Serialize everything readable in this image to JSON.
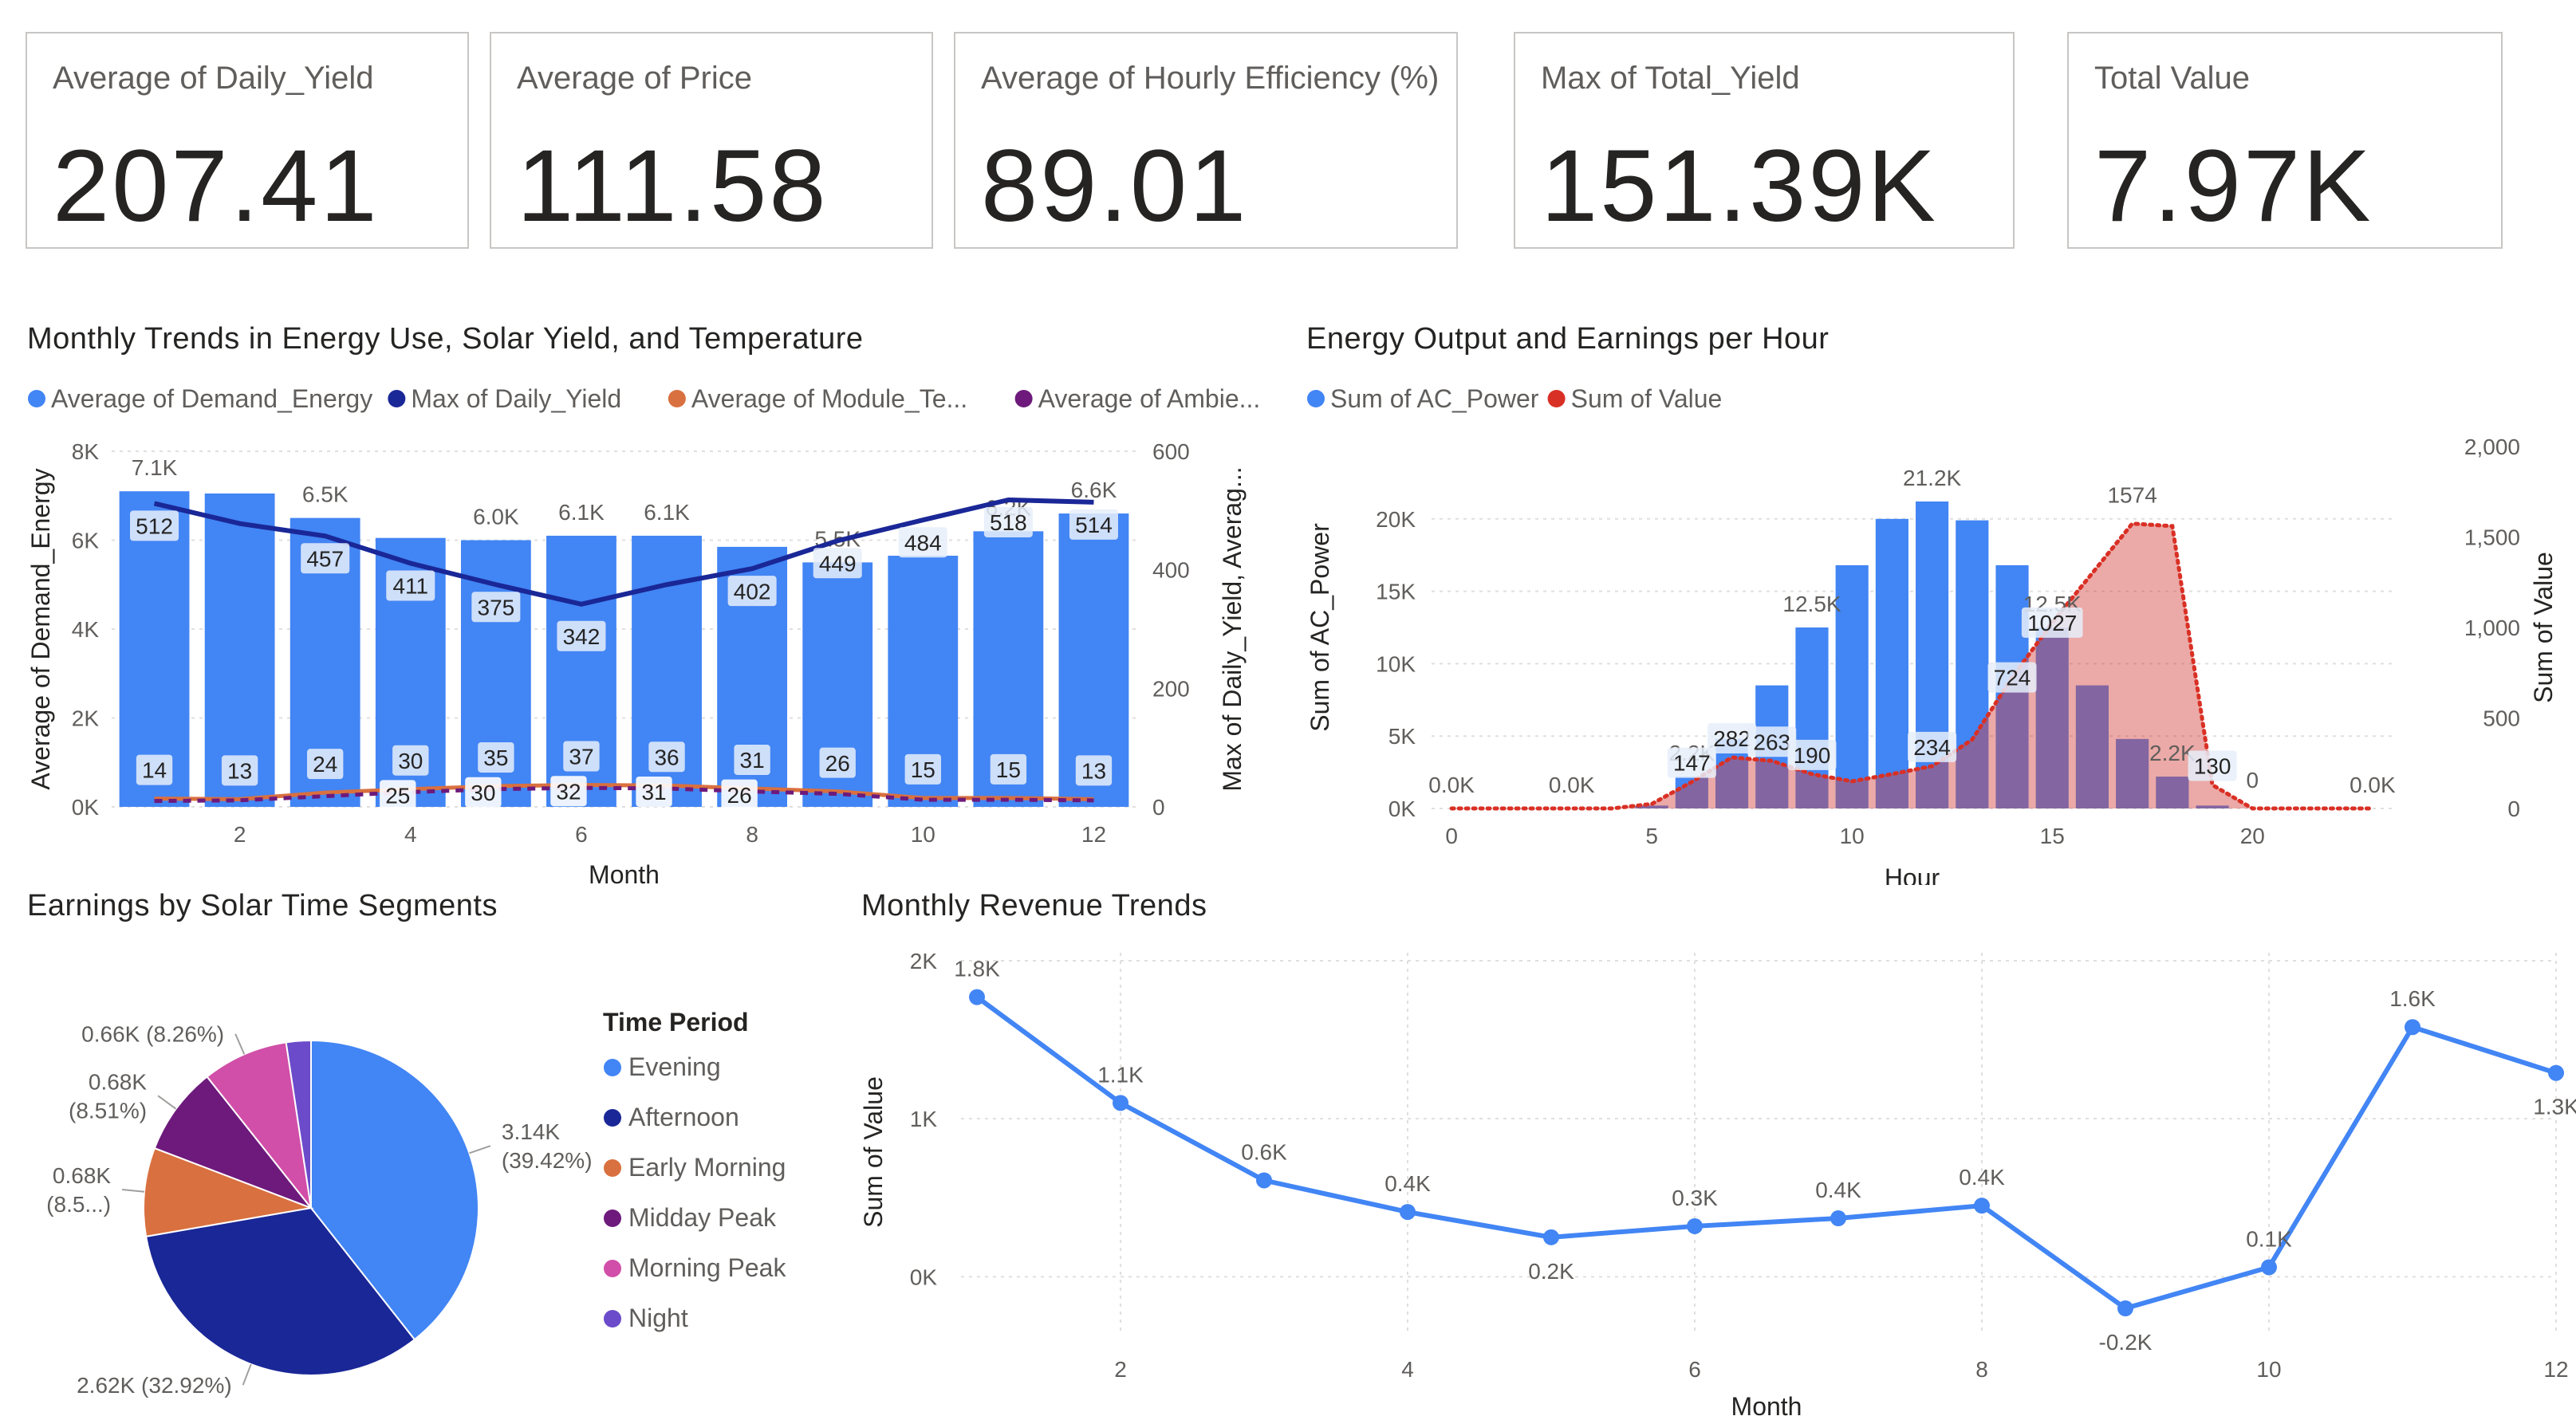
{
  "cards": [
    {
      "label": "Average of Daily_Yield",
      "value": "207.41"
    },
    {
      "label": "Average of Price",
      "value": "111.58"
    },
    {
      "label": "Average of Hourly Efficiency (%)",
      "value": "89.01"
    },
    {
      "label": "Max of Total_Yield",
      "value": "151.39K"
    },
    {
      "label": "Total Value",
      "value": "7.97K"
    }
  ],
  "colors": {
    "blue": "#4285f4",
    "navy": "#1a2797",
    "orange": "#d9703f",
    "purple": "#6d1a7c",
    "pink": "#d14fa8",
    "violet": "#6b4bc9",
    "red": "#d93025",
    "grid": "#e1dfdd",
    "text": "#605e5c"
  },
  "chart_data": [
    {
      "type": "bar",
      "title": "Monthly Trends in Energy Use, Solar Yield, and Temperature",
      "legend_position": "top-left",
      "legend": [
        "Average of Demand_Energy",
        "Max of Daily_Yield",
        "Average of Module_Te...",
        "Average of Ambie..."
      ],
      "xlabel": "Month",
      "ylabel": "Average of Demand_Energy",
      "ylabel_right": "Max of Daily_Yield, Averag...",
      "x": [
        1,
        2,
        3,
        4,
        5,
        6,
        7,
        8,
        9,
        10,
        11,
        12
      ],
      "x_ticks": [
        "2",
        "4",
        "6",
        "8",
        "10",
        "12"
      ],
      "y_ticks": [
        "0K",
        "2K",
        "4K",
        "6K",
        "8K"
      ],
      "y_right_ticks": [
        "0",
        "200",
        "400",
        "600"
      ],
      "ylim": [
        0,
        8000
      ],
      "ylim_right": [
        0,
        600
      ],
      "series": [
        {
          "name": "Average of Demand_Energy",
          "axis": "left",
          "kind": "bar",
          "values": [
            7100,
            7050,
            6500,
            6050,
            6000,
            6100,
            6100,
            5850,
            5500,
            5650,
            6200,
            6600
          ],
          "labels": [
            "7.1K",
            "",
            "6.5K",
            "",
            "6.0K",
            "6.1K",
            "6.1K",
            "",
            "5.5K",
            "",
            "6.2K",
            "6.6K"
          ]
        },
        {
          "name": "Max of Daily_Yield",
          "axis": "right",
          "kind": "line",
          "values": [
            512,
            478,
            457,
            411,
            375,
            342,
            375,
            402,
            449,
            484,
            518,
            514
          ],
          "labels": [
            "512",
            "",
            "457",
            "411",
            "375",
            "342",
            "",
            "402",
            "449",
            "484",
            "518",
            "514"
          ]
        },
        {
          "name": "Average of Module_Te...",
          "axis": "right",
          "kind": "line",
          "values": [
            14,
            13,
            24,
            30,
            35,
            37,
            36,
            31,
            26,
            15,
            15,
            13
          ],
          "labels": [
            "14",
            "13",
            "24",
            "30",
            "35",
            "37",
            "36",
            "31",
            "26",
            "15",
            "15",
            "13"
          ]
        },
        {
          "name": "Average of Ambie...",
          "axis": "right",
          "kind": "line",
          "values": [
            10,
            11,
            18,
            25,
            30,
            32,
            31,
            26,
            22,
            12,
            12,
            11
          ],
          "labels": [
            "",
            "",
            "",
            "25",
            "30",
            "32",
            "31",
            "26",
            "",
            "",
            "",
            ""
          ]
        }
      ]
    },
    {
      "type": "bar",
      "title": "Energy Output and Earnings per Hour",
      "legend_position": "top-left",
      "legend": [
        "Sum of AC_Power",
        "Sum of Value"
      ],
      "xlabel": "Hour",
      "ylabel": "Sum of AC_Power",
      "ylabel_right": "Sum of Value",
      "x": [
        0,
        1,
        2,
        3,
        4,
        5,
        6,
        7,
        8,
        9,
        10,
        11,
        12,
        13,
        14,
        15,
        16,
        17,
        18,
        19,
        20,
        21,
        22,
        23
      ],
      "x_ticks": [
        "0",
        "5",
        "10",
        "15",
        "20"
      ],
      "y_ticks": [
        "0K",
        "5K",
        "10K",
        "15K",
        "20K"
      ],
      "y_right_ticks": [
        "0",
        "500",
        "1,000",
        "1,500",
        "2,000"
      ],
      "ylim": [
        0,
        25000
      ],
      "ylim_right": [
        0,
        2000
      ],
      "series": [
        {
          "name": "Sum of AC_Power",
          "axis": "left",
          "kind": "bar",
          "values": [
            0,
            0,
            0,
            0,
            0,
            200,
            2200,
            4800,
            8500,
            12500,
            16800,
            20000,
            21200,
            19900,
            16800,
            12500,
            8500,
            4800,
            2200,
            200,
            0,
            0,
            0,
            0
          ],
          "labels": [
            "0.0K",
            "",
            "",
            "0.0K",
            "",
            "",
            "2.2K",
            "",
            "",
            "12.5K",
            "",
            "",
            "21.2K",
            "",
            "",
            "12.5K",
            "",
            "",
            "2.2K",
            "",
            "",
            "",
            "",
            "0.0K"
          ]
        },
        {
          "name": "Sum of Value",
          "axis": "right",
          "kind": "area",
          "values": [
            0,
            0,
            0,
            0,
            0,
            25,
            147,
            282,
            263,
            190,
            150,
            190,
            234,
            380,
            724,
            1027,
            1300,
            1574,
            1560,
            130,
            0,
            0,
            0,
            0
          ],
          "labels": [
            "",
            "",
            "",
            "",
            "",
            "",
            "147",
            "282",
            "263",
            "190",
            "",
            "",
            "234",
            "",
            "724",
            "1027",
            "",
            "1574",
            "",
            "130",
            "0",
            "",
            "",
            ""
          ]
        }
      ]
    },
    {
      "type": "pie",
      "title": "Earnings by Solar Time Segments",
      "legend_title": "Time Period",
      "legend_position": "right",
      "categories": [
        "Evening",
        "Afternoon",
        "Early Morning",
        "Midday Peak",
        "Morning Peak",
        "Night"
      ],
      "values": [
        3140,
        2620,
        680,
        680,
        660,
        190
      ],
      "percents": [
        39.42,
        32.92,
        8.5,
        8.51,
        8.26,
        2.39
      ],
      "labels": [
        "3.14K\n(39.42%)",
        "2.62K (32.92%)",
        "0.68K\n(8.5...)",
        "0.68K\n(8.51%)",
        "0.66K (8.26%)",
        ""
      ]
    },
    {
      "type": "line",
      "title": "Monthly Revenue Trends",
      "xlabel": "Month",
      "ylabel": "Sum of Value",
      "x": [
        1,
        2,
        3,
        4,
        5,
        6,
        7,
        8,
        9,
        10,
        11,
        12
      ],
      "x_ticks": [
        "2",
        "4",
        "6",
        "8",
        "10",
        "12"
      ],
      "y_ticks": [
        "0K",
        "1K",
        "2K"
      ],
      "ylim": [
        -200,
        2000
      ],
      "values": [
        1770,
        1100,
        610,
        410,
        250,
        320,
        370,
        450,
        -200,
        60,
        1580,
        1290
      ],
      "labels": [
        "1.8K",
        "1.1K",
        "0.6K",
        "0.4K",
        "0.2K",
        "0.3K",
        "0.4K",
        "0.4K",
        "-0.2K",
        "0.1K",
        "1.6K",
        "1.3K"
      ]
    }
  ]
}
